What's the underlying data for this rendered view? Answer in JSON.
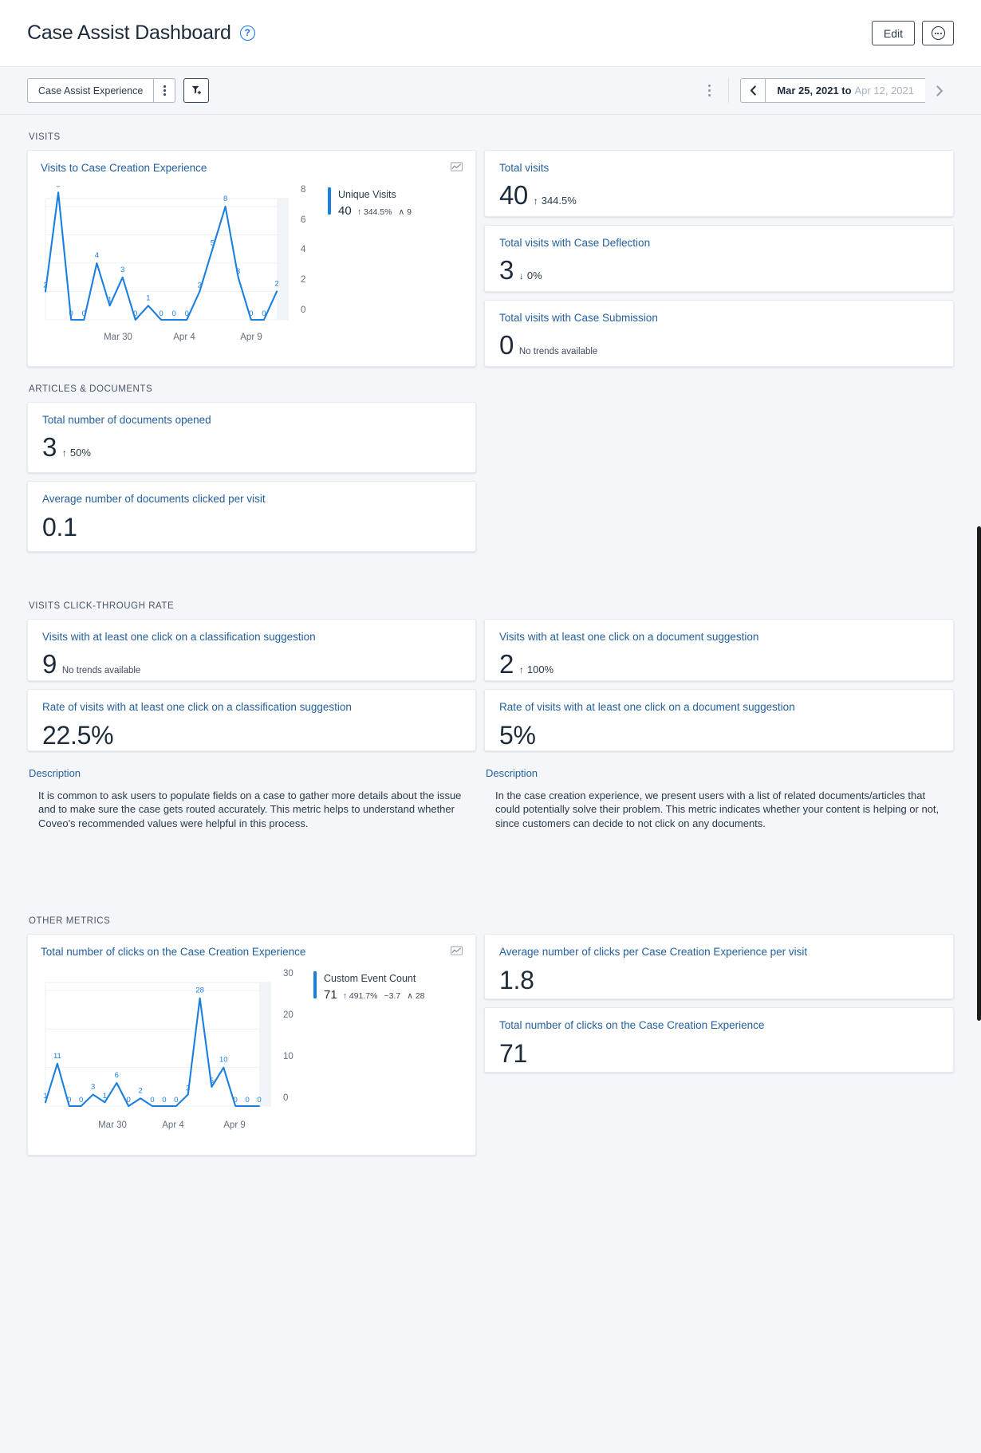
{
  "header": {
    "title": "Case Assist Dashboard",
    "help_icon": "question-circle-icon",
    "edit_label": "Edit",
    "more_icon": "more-options-circle-icon"
  },
  "filterbar": {
    "experience_label": "Case Assist Experience",
    "experience_kebab_icon": "kebab-menu-icon",
    "add_filter_icon": "add-filter-icon",
    "bar_kebab_icon": "kebab-menu-icon",
    "date_prev_icon": "chevron-left-icon",
    "date_next_icon": "chevron-right-icon",
    "date_from": "Mar 25, 2021 to",
    "date_to": "Apr 12, 2021"
  },
  "sections": {
    "visits": "VISITS",
    "articles": "ARTICLES & DOCUMENTS",
    "ctr": "VISITS CLICK-THROUGH RATE",
    "other": "OTHER METRICS"
  },
  "visits_kpis": [
    {
      "title": "Total visits",
      "value": "40",
      "arrow": "↑",
      "trend": "344.5%",
      "note": ""
    },
    {
      "title": "Total visits with Case Deflection",
      "value": "3",
      "arrow": "↓",
      "trend": "0%",
      "note": ""
    },
    {
      "title": "Total visits with Case Submission",
      "value": "0",
      "arrow": "",
      "trend": "",
      "note": "No trends available"
    }
  ],
  "articles_kpis": [
    {
      "title": "Total number of documents opened",
      "value": "3",
      "arrow": "↑",
      "trend": "50%",
      "note": ""
    },
    {
      "title": "Average number of documents clicked per visit",
      "value": "0.1",
      "arrow": "",
      "trend": "",
      "note": ""
    }
  ],
  "ctr_kpis": [
    {
      "title": "Visits with at least one click on a classification suggestion",
      "value": "9",
      "arrow": "",
      "trend": "",
      "note": "No trends available"
    },
    {
      "title": "Visits with at least one click on a document suggestion",
      "value": "2",
      "arrow": "↑",
      "trend": "100%",
      "note": ""
    },
    {
      "title": "Rate of visits with at least one click on a classification suggestion",
      "value": "22.5%",
      "arrow": "",
      "trend": "",
      "note": ""
    },
    {
      "title": "Rate of visits with at least one click on a document suggestion",
      "value": "5%",
      "arrow": "",
      "trend": "",
      "note": ""
    }
  ],
  "descriptions": [
    {
      "label": "Description",
      "text": "It is common to ask users to populate fields on a case to gather more details about the issue and to make sure the case gets routed accurately. This metric helps to understand whether Coveo's recommended values were helpful in this process."
    },
    {
      "label": "Description",
      "text": "In the case creation experience, we present users with a list of related documents/articles that could potentially solve their problem. This metric indicates whether your content is helping or not, since customers can decide to not click on any documents."
    }
  ],
  "other_kpis": [
    {
      "title": "Average number of clicks per Case Creation Experience per visit",
      "value": "1.8",
      "arrow": "",
      "trend": "",
      "note": ""
    },
    {
      "title": "Total number of clicks on the Case Creation Experience",
      "value": "71",
      "arrow": "",
      "trend": "",
      "note": ""
    }
  ],
  "colors": {
    "accent": "#1b7fe0",
    "card_title": "#24609e",
    "text": "#2b3a4a",
    "background": "#f4f6f9"
  },
  "chart_data": [
    {
      "type": "line",
      "title": "Visits to Case Creation Experience",
      "legend_icon": "chart-legend-icon",
      "series": [
        {
          "name": "Unique Visits",
          "total": "40",
          "arrow": "↑",
          "change": "344.5%",
          "peak_icon": "∧",
          "peak": "9",
          "values": [
            2,
            9,
            0,
            0,
            4,
            1,
            3,
            0,
            1,
            0,
            0,
            0,
            2,
            5,
            8,
            3,
            0,
            0,
            2
          ]
        }
      ],
      "x": [
        "Mar 25",
        "Mar 26",
        "Mar 27",
        "Mar 28",
        "Mar 29",
        "Mar 30",
        "Mar 31",
        "Apr 1",
        "Apr 2",
        "Apr 3",
        "Apr 4",
        "Apr 5",
        "Apr 6",
        "Apr 7",
        "Apr 8",
        "Apr 9",
        "Apr 10",
        "Apr 11",
        "Apr 12"
      ],
      "xtick_labels": [
        "Mar 30",
        "Apr 4",
        "Apr 9"
      ],
      "xtick_indices": [
        5,
        10,
        15
      ],
      "ylabel": "",
      "xlabel": "",
      "yticks": [
        0,
        2,
        4,
        6,
        8
      ],
      "ylim": [
        0,
        9
      ],
      "grid": true,
      "legend_position": "right"
    },
    {
      "type": "line",
      "title": "Total number of clicks on the Case Creation Experience",
      "legend_icon": "chart-legend-icon",
      "series": [
        {
          "name": "Custom Event Count",
          "total": "71",
          "arrow": "↑",
          "change": "491.7%",
          "avg_icon": "~",
          "avg": "3.7",
          "peak_icon": "∧",
          "peak": "28",
          "values": [
            1,
            11,
            0,
            0,
            3,
            1,
            6,
            0,
            2,
            0,
            0,
            0,
            3,
            28,
            5,
            10,
            0,
            0,
            0
          ]
        }
      ],
      "x": [
        "Mar 25",
        "Mar 26",
        "Mar 27",
        "Mar 28",
        "Mar 29",
        "Mar 30",
        "Mar 31",
        "Apr 1",
        "Apr 2",
        "Apr 3",
        "Apr 4",
        "Apr 5",
        "Apr 6",
        "Apr 7",
        "Apr 8",
        "Apr 9",
        "Apr 10",
        "Apr 11",
        "Apr 12"
      ],
      "xtick_labels": [
        "Mar 30",
        "Apr 4",
        "Apr 9"
      ],
      "xtick_indices": [
        5,
        10,
        15
      ],
      "ylabel": "",
      "xlabel": "",
      "yticks": [
        0,
        10,
        20,
        30
      ],
      "ylim": [
        0,
        30
      ],
      "grid": true,
      "legend_position": "right"
    }
  ]
}
